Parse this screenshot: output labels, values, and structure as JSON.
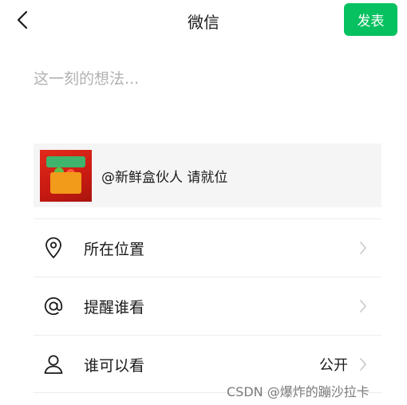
{
  "header": {
    "title": "微信",
    "publish_label": "发表"
  },
  "composer": {
    "placeholder": "这一刻的想法..."
  },
  "share_card": {
    "text": "@新鲜盒伙人 请就位"
  },
  "settings": {
    "location_label": "所在位置",
    "remind_label": "提醒谁看",
    "visibility_label": "谁可以看",
    "visibility_value": "公开"
  },
  "watermark": {
    "text": "CSDN @爆炸的蹦沙拉卡"
  },
  "colors": {
    "accent": "#07c160",
    "card_bg": "#f5f5f5",
    "placeholder": "#b2b2b2",
    "divider": "#ededed"
  },
  "icons": [
    "back-chevron-icon",
    "location-pin-icon",
    "at-sign-icon",
    "person-icon",
    "chevron-right-icon"
  ]
}
